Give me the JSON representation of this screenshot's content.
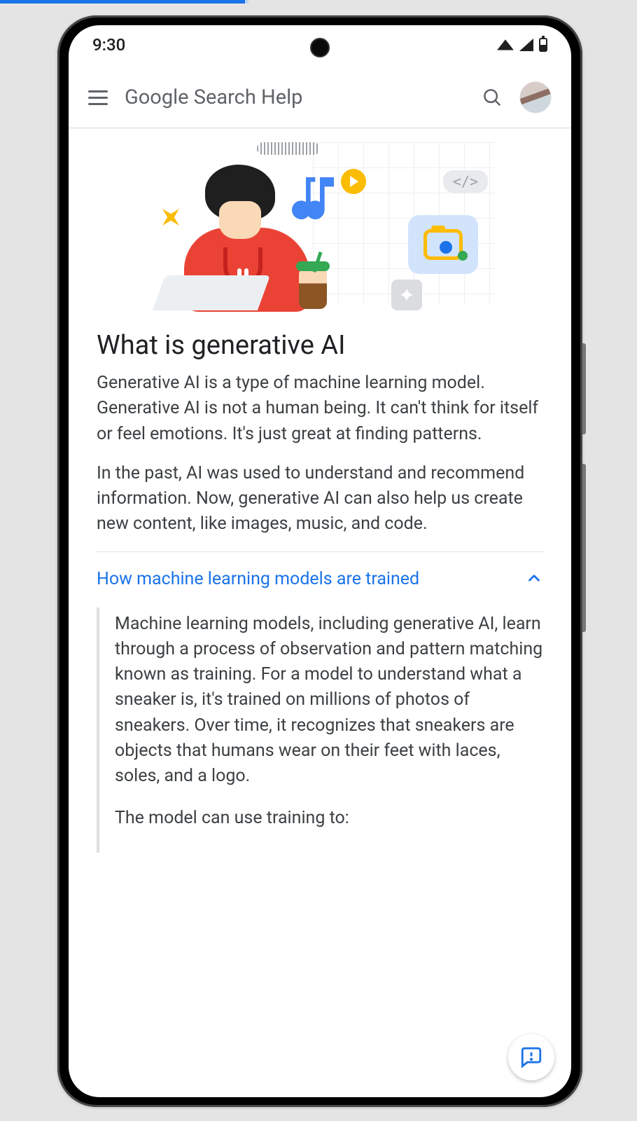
{
  "status": {
    "time": "9:30"
  },
  "header": {
    "title": "Google Search Help"
  },
  "hero": {
    "code_chip": "</>"
  },
  "article": {
    "title": "What is generative AI",
    "p1": "Generative AI is a type of machine learning model. Generative AI is not a human being. It can't think for itself or feel emotions. It's just great at finding patterns.",
    "p2": "In the past, AI was used to understand and recommend information. Now, generative AI can also help us create new content, like images, music, and code."
  },
  "accordion": {
    "title": "How machine learning models are trained",
    "expanded_p1": "Machine learning models, including generative AI, learn through a process of observation and pattern matching known as training. For a model to understand what a sneaker is, it's trained on millions of photos of sneakers. Over time, it recognizes that sneakers are objects that humans wear on their feet with laces, soles, and a logo.",
    "expanded_p2": "The model can use training to:"
  }
}
